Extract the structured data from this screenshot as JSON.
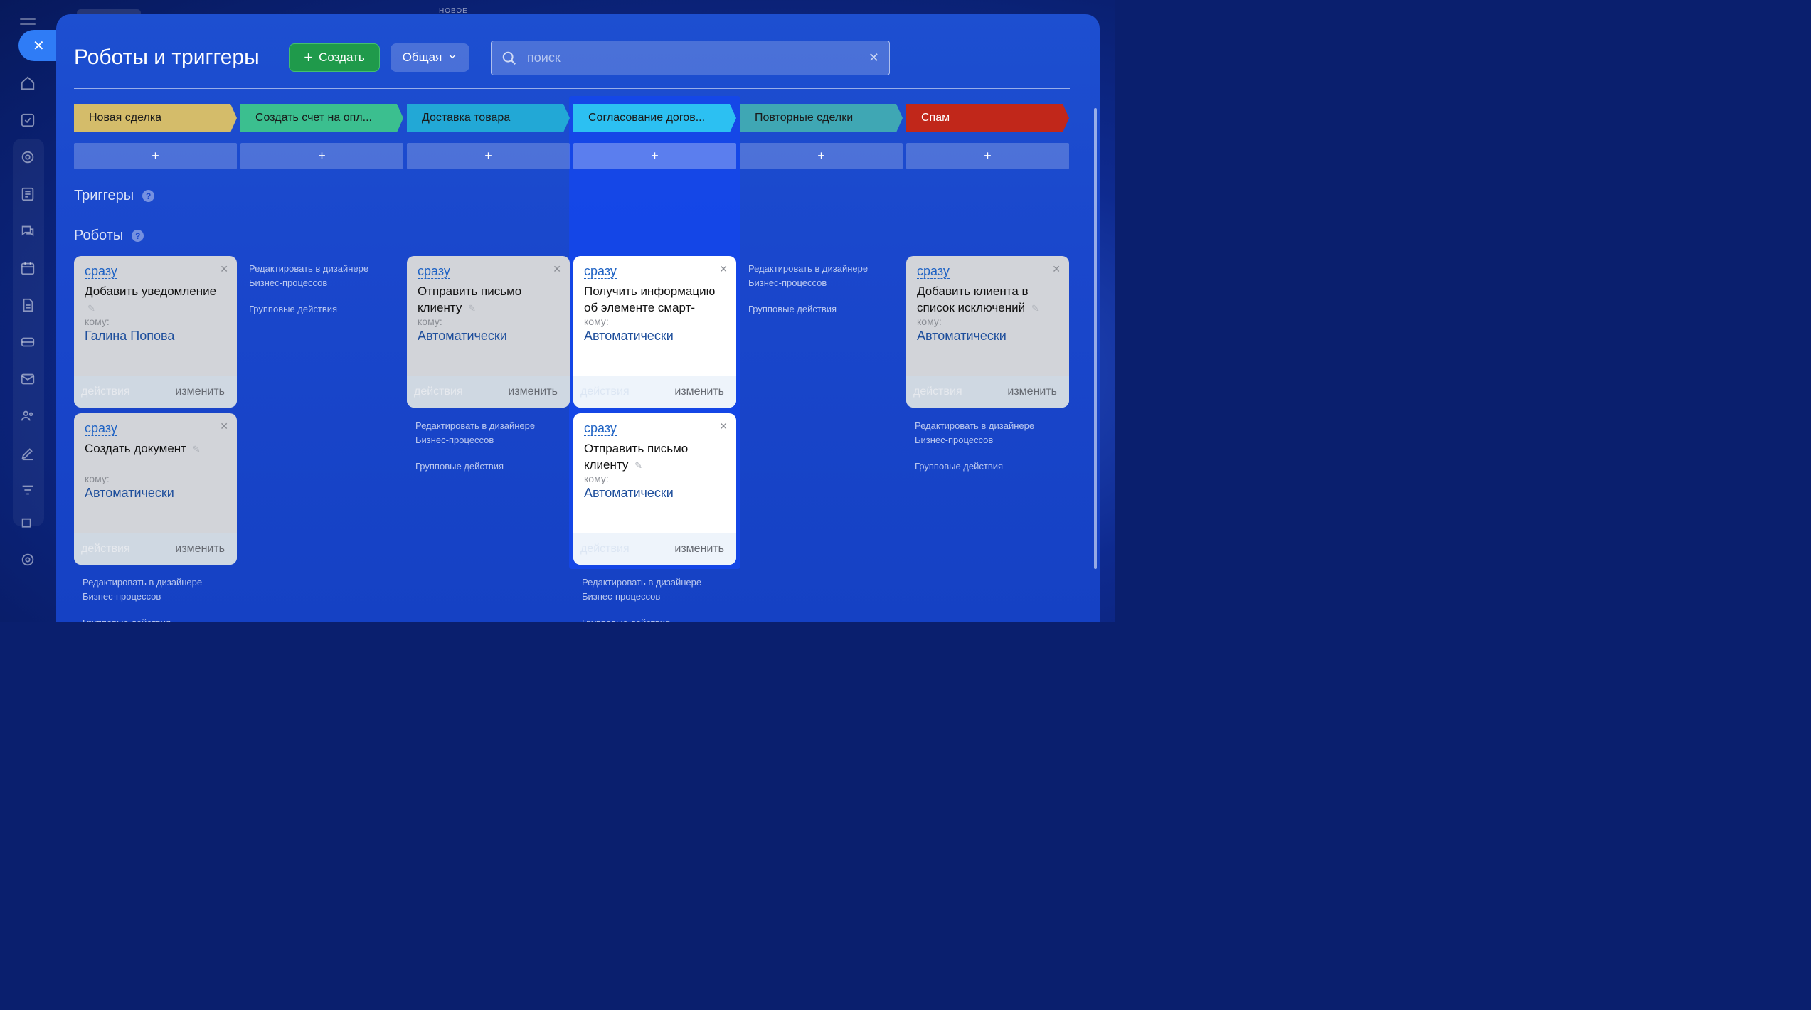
{
  "window": {
    "top_label": "НОВОЕ"
  },
  "header": {
    "title": "Роботы и триггеры",
    "create_label": "Создать",
    "filter_label": "Общая",
    "search_placeholder": "поиск"
  },
  "stages": [
    {
      "label": "Новая сделка",
      "color": "#d4bc6a",
      "add": "+"
    },
    {
      "label": "Создать счет на опл...",
      "color": "#3bbf8f",
      "add": "+"
    },
    {
      "label": "Доставка товара",
      "color": "#22a8d6",
      "add": "+"
    },
    {
      "label": "Согласование догов...",
      "color": "#2cc0f2",
      "add": "+"
    },
    {
      "label": "Повторные сделки",
      "color": "#3fa7b4",
      "add": "+"
    },
    {
      "label": "Спам",
      "color": "#c1271a",
      "add": "+"
    }
  ],
  "sections": {
    "triggers": "Триггеры",
    "robots": "Роботы",
    "help": "?"
  },
  "robots": [
    {
      "when": "сразу",
      "name": "Добавить уведомление",
      "to_label": "кому:",
      "to_value": "Галина Попова",
      "actions": "действия",
      "edit": "изменить"
    },
    {
      "when": "сразу",
      "name": "Создать документ",
      "to_label": "кому:",
      "to_value": "Автоматически",
      "actions": "действия",
      "edit": "изменить"
    },
    {
      "when": "сразу",
      "name": "Отправить письмо клиенту",
      "to_label": "кому:",
      "to_value": "Автоматически",
      "actions": "действия",
      "edit": "изменить"
    },
    {
      "when": "сразу",
      "name": "Получить информацию об элементе смарт-",
      "to_label": "кому:",
      "to_value": "Автоматически",
      "actions": "действия",
      "edit": "изменить"
    },
    {
      "when": "сразу",
      "name": "Отправить письмо клиенту",
      "to_label": "кому:",
      "to_value": "Автоматически",
      "actions": "действия",
      "edit": "изменить"
    },
    {
      "when": "сразу",
      "name": "Добавить клиента в список исключений",
      "to_label": "кому:",
      "to_value": "Автоматически",
      "actions": "действия",
      "edit": "изменить"
    }
  ],
  "links": {
    "designer": "Редактировать в дизайнере Бизнес-процессов",
    "group": "Групповые действия",
    "group_cut": "Групповые действия"
  }
}
